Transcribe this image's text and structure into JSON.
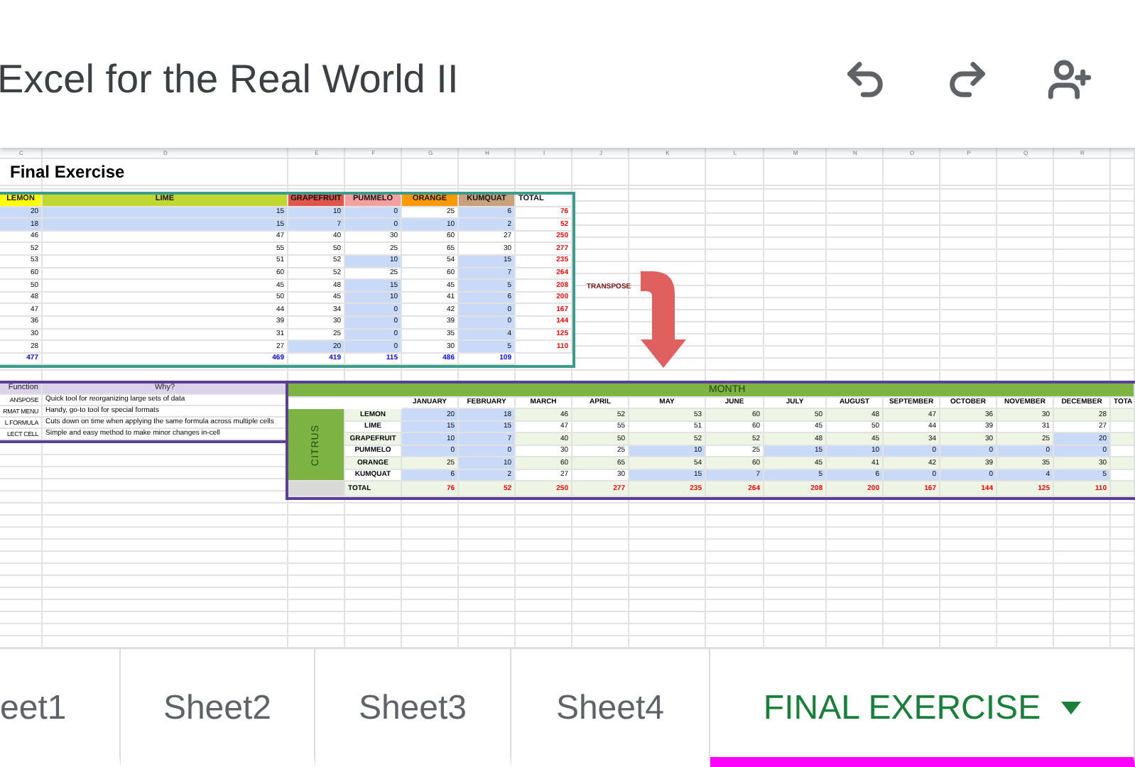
{
  "app_bar": {
    "title": "Excel for the Real World II",
    "actions": [
      {
        "kind": "undo"
      },
      {
        "kind": "redo"
      },
      {
        "kind": "add-person"
      }
    ]
  },
  "sheet": {
    "columns": [
      "C",
      "D",
      "E",
      "F",
      "G",
      "H",
      "I",
      "J",
      "K",
      "L",
      "M",
      "N",
      "O",
      "P",
      "Q",
      "R"
    ],
    "title": "Final Exercise",
    "fruit_table": {
      "headers": [
        {
          "label": "LEMON",
          "color": "#ffff00"
        },
        {
          "label": "LIME",
          "color": "#bfd730"
        },
        {
          "label": "GRAPEFRUIT",
          "color": "#e0564b"
        },
        {
          "label": "PUMMELO",
          "color": "#f4a0a0"
        },
        {
          "label": "ORANGE",
          "color": "#ff9900"
        },
        {
          "label": "KUMQUAT",
          "color": "#c8a27c"
        },
        {
          "label": "TOTAL",
          "color": "#ffffff"
        }
      ],
      "rows": [
        {
          "values": [
            "20",
            "15",
            "10",
            "0",
            "25",
            "6"
          ],
          "highlighted": [
            true,
            true,
            true,
            true,
            false,
            true
          ],
          "total": "76"
        },
        {
          "values": [
            "18",
            "15",
            "7",
            "0",
            "10",
            "2"
          ],
          "highlighted": [
            true,
            true,
            true,
            true,
            true,
            true
          ],
          "total": "52"
        },
        {
          "values": [
            "46",
            "47",
            "40",
            "30",
            "60",
            "27"
          ],
          "highlighted": [
            false,
            false,
            false,
            false,
            false,
            false
          ],
          "total": "250"
        },
        {
          "values": [
            "52",
            "55",
            "50",
            "25",
            "65",
            "30"
          ],
          "highlighted": [
            false,
            false,
            false,
            false,
            false,
            false
          ],
          "total": "277"
        },
        {
          "values": [
            "53",
            "51",
            "52",
            "10",
            "54",
            "15"
          ],
          "highlighted": [
            false,
            false,
            false,
            true,
            false,
            true
          ],
          "total": "235"
        },
        {
          "values": [
            "60",
            "60",
            "52",
            "25",
            "60",
            "7"
          ],
          "highlighted": [
            false,
            false,
            false,
            false,
            false,
            true
          ],
          "total": "264"
        },
        {
          "values": [
            "50",
            "45",
            "48",
            "15",
            "45",
            "5"
          ],
          "highlighted": [
            false,
            false,
            false,
            true,
            false,
            true
          ],
          "total": "208"
        },
        {
          "values": [
            "48",
            "50",
            "45",
            "10",
            "41",
            "6"
          ],
          "highlighted": [
            false,
            false,
            false,
            true,
            false,
            true
          ],
          "total": "200"
        },
        {
          "values": [
            "47",
            "44",
            "34",
            "0",
            "42",
            "0"
          ],
          "highlighted": [
            false,
            false,
            false,
            true,
            false,
            true
          ],
          "total": "167"
        },
        {
          "values": [
            "36",
            "39",
            "30",
            "0",
            "39",
            "0"
          ],
          "highlighted": [
            false,
            false,
            false,
            true,
            false,
            true
          ],
          "total": "144"
        },
        {
          "values": [
            "30",
            "31",
            "25",
            "0",
            "35",
            "4"
          ],
          "highlighted": [
            false,
            false,
            false,
            true,
            false,
            true
          ],
          "total": "125"
        },
        {
          "values": [
            "28",
            "27",
            "20",
            "0",
            "30",
            "5"
          ],
          "highlighted": [
            false,
            false,
            true,
            true,
            false,
            true
          ],
          "total": "110"
        }
      ],
      "totals": [
        "477",
        "469",
        "419",
        "115",
        "486",
        "109"
      ]
    },
    "transpose_label": "TRANSPOSE",
    "functions_table": {
      "columns": [
        "Function",
        "Why?"
      ],
      "rows": [
        [
          "ANSPOSE",
          "Quick tool for reorganizing large sets of data"
        ],
        [
          "RMAT MENU",
          "Handy, go-to tool for special formats"
        ],
        [
          "L FORMULA",
          "Cuts down on time when applying the same formula across multiple cells"
        ],
        [
          "LECT CELL",
          "Simple and easy method to make minor changes in-cell"
        ]
      ]
    },
    "month_table": {
      "header": "MONTH",
      "group_label": "CITRUS",
      "months": [
        "JANUARY",
        "FEBRUARY",
        "MARCH",
        "APRIL",
        "MAY",
        "JUNE",
        "JULY",
        "AUGUST",
        "SEPTEMBER",
        "OCTOBER",
        "NOVEMBER",
        "DECEMBER"
      ],
      "extra_column": "TOTA",
      "rows": [
        {
          "fruit": "LEMON",
          "values": [
            "20",
            "18",
            "46",
            "52",
            "53",
            "60",
            "50",
            "48",
            "47",
            "36",
            "30",
            "28"
          ],
          "highlighted": [
            true,
            true,
            false,
            false,
            false,
            false,
            false,
            false,
            false,
            false,
            false,
            false
          ]
        },
        {
          "fruit": "LIME",
          "values": [
            "15",
            "15",
            "47",
            "55",
            "51",
            "60",
            "45",
            "50",
            "44",
            "39",
            "31",
            "27"
          ],
          "highlighted": [
            true,
            true,
            false,
            false,
            false,
            false,
            false,
            false,
            false,
            false,
            false,
            false
          ]
        },
        {
          "fruit": "GRAPEFRUIT",
          "values": [
            "10",
            "7",
            "40",
            "50",
            "52",
            "52",
            "48",
            "45",
            "34",
            "30",
            "25",
            "20"
          ],
          "highlighted": [
            true,
            true,
            false,
            false,
            false,
            false,
            false,
            false,
            false,
            false,
            false,
            true
          ]
        },
        {
          "fruit": "PUMMELO",
          "values": [
            "0",
            "0",
            "30",
            "25",
            "10",
            "25",
            "15",
            "10",
            "0",
            "0",
            "0",
            "0"
          ],
          "highlighted": [
            true,
            true,
            false,
            false,
            true,
            false,
            true,
            true,
            true,
            true,
            true,
            true
          ]
        },
        {
          "fruit": "ORANGE",
          "values": [
            "25",
            "10",
            "60",
            "65",
            "54",
            "60",
            "45",
            "41",
            "42",
            "39",
            "35",
            "30"
          ],
          "highlighted": [
            false,
            true,
            false,
            false,
            false,
            false,
            false,
            false,
            false,
            false,
            false,
            false
          ]
        },
        {
          "fruit": "KUMQUAT",
          "values": [
            "6",
            "2",
            "27",
            "30",
            "15",
            "7",
            "5",
            "6",
            "0",
            "0",
            "4",
            "5"
          ],
          "highlighted": [
            true,
            true,
            false,
            false,
            true,
            true,
            true,
            true,
            true,
            true,
            true,
            true
          ]
        }
      ],
      "total_label": "TOTAL",
      "totals": [
        "76",
        "52",
        "250",
        "277",
        "235",
        "264",
        "208",
        "200",
        "167",
        "144",
        "125",
        "110"
      ]
    }
  },
  "tabs": [
    {
      "label": "eet1",
      "selected": false
    },
    {
      "label": "Sheet2",
      "selected": false
    },
    {
      "label": "Sheet3",
      "selected": false
    },
    {
      "label": "Sheet4",
      "selected": false
    },
    {
      "label": "FINAL EXERCISE",
      "selected": true
    }
  ]
}
